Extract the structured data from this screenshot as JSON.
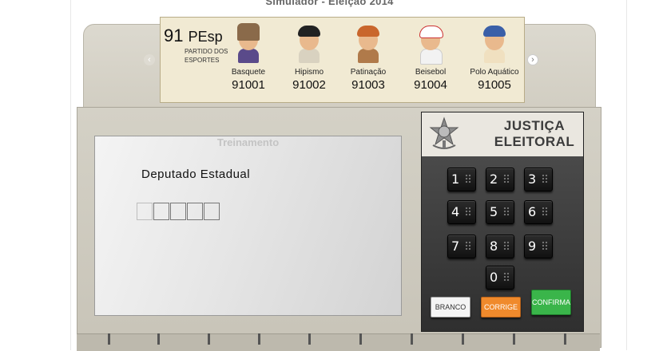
{
  "title": "Simulador - Eleição 2014",
  "party": {
    "number": "91",
    "acronym": "PEsp",
    "name": "PARTIDO DOS ESPORTES"
  },
  "candidates": [
    {
      "sport": "Basquete",
      "number": "91001",
      "hat": "#8a6a4a",
      "shirt": "#5a4a8a"
    },
    {
      "sport": "Hipismo",
      "number": "91002",
      "hat": "#222222",
      "shirt": "#d9d2c0"
    },
    {
      "sport": "Patinação",
      "number": "91003",
      "hat": "#c9662c",
      "shirt": "#b07a4a"
    },
    {
      "sport": "Beisebol",
      "number": "91004",
      "hat": "#ffffff",
      "shirt": "#f2f2f2"
    },
    {
      "sport": "Polo Aquático",
      "number": "91005",
      "hat": "#3a5fa8",
      "shirt": "#f0e0c0"
    }
  ],
  "screen": {
    "watermark": "Treinamento",
    "office": "Deputado Estadual"
  },
  "panel": {
    "line1": "JUSTIÇA",
    "line2": "ELEITORAL",
    "seal_icon": "brasil-coat-of-arms-icon"
  },
  "keys": [
    "1",
    "2",
    "3",
    "4",
    "5",
    "6",
    "7",
    "8",
    "9",
    "0"
  ],
  "buttons": {
    "branco": "BRANCO",
    "corrige": "CORRIGE",
    "confirma": "CONFIRMA"
  },
  "colors": {
    "branco": "#f4f4f4",
    "corrige": "#f08a2c",
    "confirma": "#3ab54a"
  }
}
